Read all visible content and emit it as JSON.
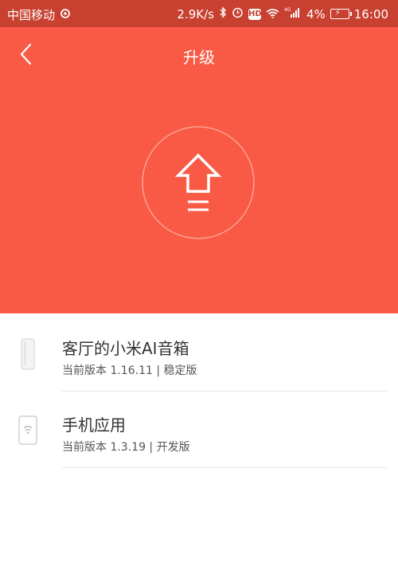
{
  "status_bar": {
    "carrier": "中国移动",
    "network_speed": "2.9K/s",
    "battery_percent": "4%",
    "time": "16:00",
    "hd_label": "HD",
    "signal_label": "4G"
  },
  "header": {
    "title": "升级",
    "background_color": "#f85a45"
  },
  "devices": [
    {
      "name": "客厅的小米AI音箱",
      "version": "当前版本 1.16.11 | 稳定版",
      "icon": "speaker-icon"
    },
    {
      "name": "手机应用",
      "version": "当前版本 1.3.19 | 开发版",
      "icon": "phone-app-icon"
    }
  ]
}
